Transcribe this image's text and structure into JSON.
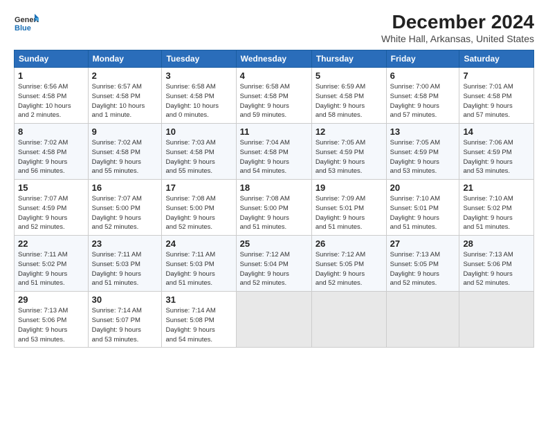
{
  "header": {
    "logo_general": "General",
    "logo_blue": "Blue",
    "title": "December 2024",
    "subtitle": "White Hall, Arkansas, United States"
  },
  "days_of_week": [
    "Sunday",
    "Monday",
    "Tuesday",
    "Wednesday",
    "Thursday",
    "Friday",
    "Saturday"
  ],
  "weeks": [
    [
      {
        "day": 1,
        "info": "Sunrise: 6:56 AM\nSunset: 4:58 PM\nDaylight: 10 hours\nand 2 minutes."
      },
      {
        "day": 2,
        "info": "Sunrise: 6:57 AM\nSunset: 4:58 PM\nDaylight: 10 hours\nand 1 minute."
      },
      {
        "day": 3,
        "info": "Sunrise: 6:58 AM\nSunset: 4:58 PM\nDaylight: 10 hours\nand 0 minutes."
      },
      {
        "day": 4,
        "info": "Sunrise: 6:58 AM\nSunset: 4:58 PM\nDaylight: 9 hours\nand 59 minutes."
      },
      {
        "day": 5,
        "info": "Sunrise: 6:59 AM\nSunset: 4:58 PM\nDaylight: 9 hours\nand 58 minutes."
      },
      {
        "day": 6,
        "info": "Sunrise: 7:00 AM\nSunset: 4:58 PM\nDaylight: 9 hours\nand 57 minutes."
      },
      {
        "day": 7,
        "info": "Sunrise: 7:01 AM\nSunset: 4:58 PM\nDaylight: 9 hours\nand 57 minutes."
      }
    ],
    [
      {
        "day": 8,
        "info": "Sunrise: 7:02 AM\nSunset: 4:58 PM\nDaylight: 9 hours\nand 56 minutes."
      },
      {
        "day": 9,
        "info": "Sunrise: 7:02 AM\nSunset: 4:58 PM\nDaylight: 9 hours\nand 55 minutes."
      },
      {
        "day": 10,
        "info": "Sunrise: 7:03 AM\nSunset: 4:58 PM\nDaylight: 9 hours\nand 55 minutes."
      },
      {
        "day": 11,
        "info": "Sunrise: 7:04 AM\nSunset: 4:58 PM\nDaylight: 9 hours\nand 54 minutes."
      },
      {
        "day": 12,
        "info": "Sunrise: 7:05 AM\nSunset: 4:59 PM\nDaylight: 9 hours\nand 53 minutes."
      },
      {
        "day": 13,
        "info": "Sunrise: 7:05 AM\nSunset: 4:59 PM\nDaylight: 9 hours\nand 53 minutes."
      },
      {
        "day": 14,
        "info": "Sunrise: 7:06 AM\nSunset: 4:59 PM\nDaylight: 9 hours\nand 53 minutes."
      }
    ],
    [
      {
        "day": 15,
        "info": "Sunrise: 7:07 AM\nSunset: 4:59 PM\nDaylight: 9 hours\nand 52 minutes."
      },
      {
        "day": 16,
        "info": "Sunrise: 7:07 AM\nSunset: 5:00 PM\nDaylight: 9 hours\nand 52 minutes."
      },
      {
        "day": 17,
        "info": "Sunrise: 7:08 AM\nSunset: 5:00 PM\nDaylight: 9 hours\nand 52 minutes."
      },
      {
        "day": 18,
        "info": "Sunrise: 7:08 AM\nSunset: 5:00 PM\nDaylight: 9 hours\nand 51 minutes."
      },
      {
        "day": 19,
        "info": "Sunrise: 7:09 AM\nSunset: 5:01 PM\nDaylight: 9 hours\nand 51 minutes."
      },
      {
        "day": 20,
        "info": "Sunrise: 7:10 AM\nSunset: 5:01 PM\nDaylight: 9 hours\nand 51 minutes."
      },
      {
        "day": 21,
        "info": "Sunrise: 7:10 AM\nSunset: 5:02 PM\nDaylight: 9 hours\nand 51 minutes."
      }
    ],
    [
      {
        "day": 22,
        "info": "Sunrise: 7:11 AM\nSunset: 5:02 PM\nDaylight: 9 hours\nand 51 minutes."
      },
      {
        "day": 23,
        "info": "Sunrise: 7:11 AM\nSunset: 5:03 PM\nDaylight: 9 hours\nand 51 minutes."
      },
      {
        "day": 24,
        "info": "Sunrise: 7:11 AM\nSunset: 5:03 PM\nDaylight: 9 hours\nand 51 minutes."
      },
      {
        "day": 25,
        "info": "Sunrise: 7:12 AM\nSunset: 5:04 PM\nDaylight: 9 hours\nand 52 minutes."
      },
      {
        "day": 26,
        "info": "Sunrise: 7:12 AM\nSunset: 5:05 PM\nDaylight: 9 hours\nand 52 minutes."
      },
      {
        "day": 27,
        "info": "Sunrise: 7:13 AM\nSunset: 5:05 PM\nDaylight: 9 hours\nand 52 minutes."
      },
      {
        "day": 28,
        "info": "Sunrise: 7:13 AM\nSunset: 5:06 PM\nDaylight: 9 hours\nand 52 minutes."
      }
    ],
    [
      {
        "day": 29,
        "info": "Sunrise: 7:13 AM\nSunset: 5:06 PM\nDaylight: 9 hours\nand 53 minutes."
      },
      {
        "day": 30,
        "info": "Sunrise: 7:14 AM\nSunset: 5:07 PM\nDaylight: 9 hours\nand 53 minutes."
      },
      {
        "day": 31,
        "info": "Sunrise: 7:14 AM\nSunset: 5:08 PM\nDaylight: 9 hours\nand 54 minutes."
      },
      null,
      null,
      null,
      null
    ]
  ]
}
